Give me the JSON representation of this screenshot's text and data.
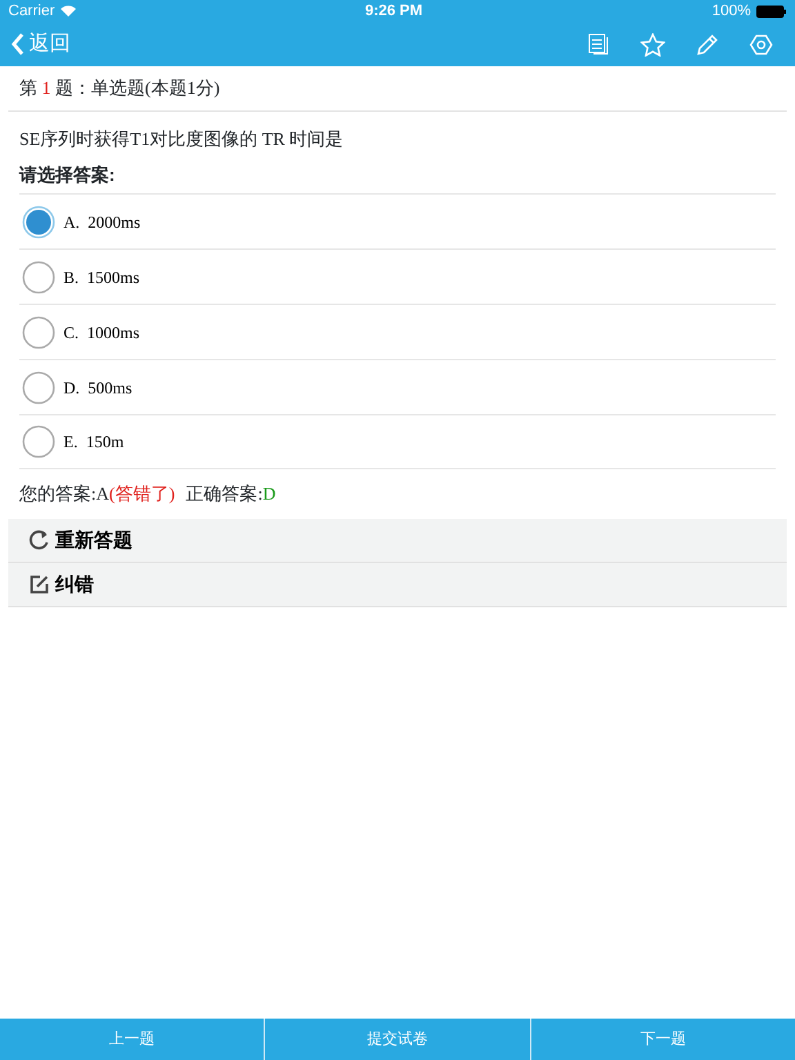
{
  "status_bar": {
    "carrier": "Carrier",
    "time": "9:26 PM",
    "battery": "100%"
  },
  "nav": {
    "back_label": "返回"
  },
  "header": {
    "prefix": "第 ",
    "number": "1",
    "suffix": " 题：单选题(本题1分)"
  },
  "question": "SE序列时获得T1对比度图像的 TR 时间是",
  "prompt": "请选择答案:",
  "options": [
    {
      "letter": "A.",
      "text": "2000ms",
      "selected": true
    },
    {
      "letter": "B.",
      "text": "1500ms",
      "selected": false
    },
    {
      "letter": "C.",
      "text": "1000ms",
      "selected": false
    },
    {
      "letter": "D.",
      "text": "500ms",
      "selected": false
    },
    {
      "letter": "E.",
      "text": "150m",
      "selected": false
    }
  ],
  "answer": {
    "label": "您的答案:",
    "value": "A",
    "verdict": "(答错了)",
    "correct_label": "正确答案:",
    "correct_value": "D"
  },
  "actions": [
    {
      "kind": "redo",
      "label": "重新答题"
    },
    {
      "kind": "report",
      "label": "纠错"
    }
  ],
  "bottom_buttons": [
    "上一题",
    "提交试卷",
    "下一题"
  ]
}
